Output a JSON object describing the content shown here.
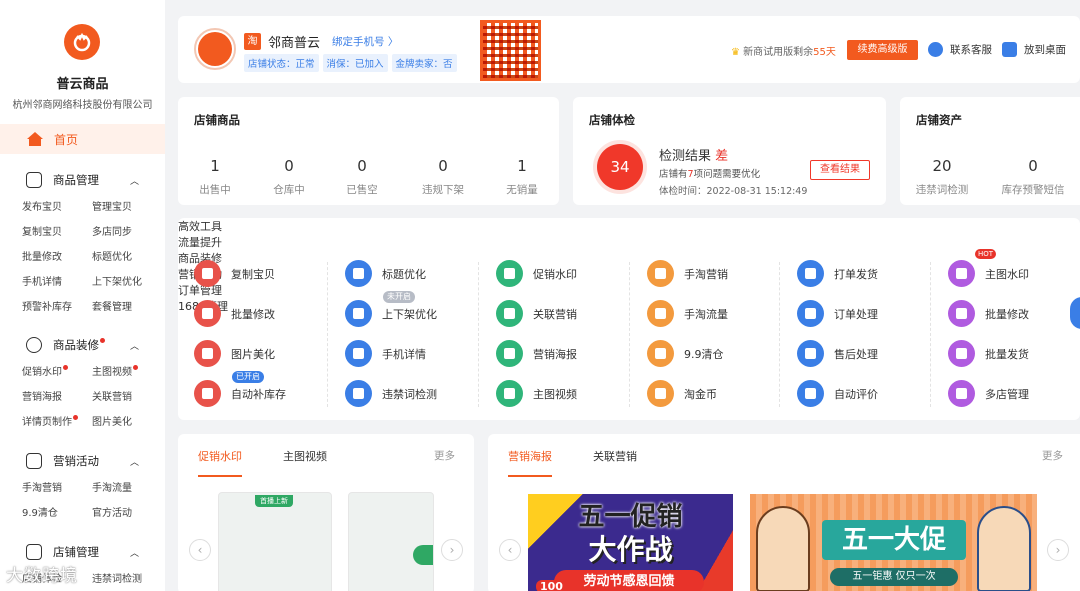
{
  "sidebar": {
    "app_name": "普云商品",
    "company": "杭州邻商网络科技股份有限公司",
    "home": "首页",
    "groups": [
      {
        "title": "商品管理",
        "items": [
          "发布宝贝",
          "管理宝贝",
          "复制宝贝",
          "多店同步",
          "批量修改",
          "标题优化",
          "手机详情",
          "上下架优化",
          "预警补库存",
          "套餐管理"
        ]
      },
      {
        "title": "商品装修",
        "items": [
          "促销水印",
          "主图视频",
          "营销海报",
          "关联营销",
          "详情页制作",
          "图片美化"
        ]
      },
      {
        "title": "营销活动",
        "items": [
          "手淘营销",
          "手淘流量",
          "9.9清仓",
          "官方活动"
        ]
      },
      {
        "title": "店铺管理",
        "items": [
          "店铺体检",
          "违禁词检测"
        ]
      }
    ]
  },
  "topbar": {
    "tao": "淘",
    "shop_name": "邻商普云",
    "bind_phone": "绑定手机号 〉",
    "tags": [
      "店铺状态：正常",
      "消保：已加入",
      "金牌卖家：否"
    ],
    "trial_prefix": "新商试用版剩余",
    "trial_days": "55天",
    "upgrade": "续费高级版",
    "contact": "联系客服",
    "desktop": "放到桌面"
  },
  "goods": {
    "title": "店铺商品",
    "stats": [
      {
        "num": "1",
        "label": "出售中"
      },
      {
        "num": "0",
        "label": "仓库中"
      },
      {
        "num": "0",
        "label": "已售空"
      },
      {
        "num": "0",
        "label": "违规下架"
      },
      {
        "num": "1",
        "label": "无销量"
      }
    ]
  },
  "check": {
    "title": "店铺体检",
    "score": "34",
    "result_label": "检测结果",
    "result": "差",
    "desc_pre": "店铺有",
    "desc_num": "7",
    "desc_post": "项问题需要优化",
    "time": "体检时间：2022-08-31 15:12:49",
    "button": "查看结果"
  },
  "assets": {
    "title": "店铺资产",
    "stats": [
      {
        "num": "20",
        "label": "违禁词检测"
      },
      {
        "num": "0",
        "label": "库存预警短信"
      }
    ]
  },
  "tools": [
    {
      "title": "高效工具",
      "items": [
        {
          "label": "复制宝贝",
          "color": "#e8524a"
        },
        {
          "label": "批量修改",
          "color": "#e8524a"
        },
        {
          "label": "图片美化",
          "color": "#e8524a"
        },
        {
          "label": "自动补库存",
          "color": "#e8524a",
          "badge": "已开启"
        }
      ]
    },
    {
      "title": "流量提升",
      "items": [
        {
          "label": "标题优化",
          "color": "#3a7ee6"
        },
        {
          "label": "上下架优化",
          "color": "#3a7ee6",
          "badge": "未开启"
        },
        {
          "label": "手机详情",
          "color": "#3a7ee6"
        },
        {
          "label": "违禁词检测",
          "color": "#3a7ee6"
        }
      ]
    },
    {
      "title": "商品装修",
      "items": [
        {
          "label": "促销水印",
          "color": "#2fb57a"
        },
        {
          "label": "关联营销",
          "color": "#2fb57a"
        },
        {
          "label": "营销海报",
          "color": "#2fb57a"
        },
        {
          "label": "主图视频",
          "color": "#2fb57a"
        }
      ]
    },
    {
      "title": "营销活动",
      "items": [
        {
          "label": "手淘营销",
          "color": "#f39a3e"
        },
        {
          "label": "手淘流量",
          "color": "#f39a3e"
        },
        {
          "label": "9.9清仓",
          "color": "#f39a3e"
        },
        {
          "label": "淘金币",
          "color": "#f39a3e"
        }
      ]
    },
    {
      "title": "订单管理",
      "items": [
        {
          "label": "打单发货",
          "color": "#3a7ee6"
        },
        {
          "label": "订单处理",
          "color": "#3a7ee6"
        },
        {
          "label": "售后处理",
          "color": "#3a7ee6"
        },
        {
          "label": "自动评价",
          "color": "#3a7ee6"
        }
      ]
    },
    {
      "title": "1688管理",
      "items": [
        {
          "label": "主图水印",
          "color": "#b05be0"
        },
        {
          "label": "批量修改",
          "color": "#b05be0"
        },
        {
          "label": "批量发货",
          "color": "#b05be0"
        },
        {
          "label": "多店管理",
          "color": "#b05be0"
        }
      ]
    }
  ],
  "hot": "HOT",
  "panel_left": {
    "tabs": [
      "促销水印",
      "主图视频"
    ],
    "more": "更多",
    "thumb_tag": "首播上新"
  },
  "panel_right": {
    "tabs": [
      "营销海报",
      "关联营销"
    ],
    "more": "更多",
    "poster1": {
      "line1": "五一促销",
      "line2": "大作战",
      "sub": "劳动节感恩回馈",
      "num": "100"
    },
    "poster2": {
      "title": "五一大促",
      "sub": "五一钜惠 仅只一次"
    }
  },
  "watermark": "大数跨境"
}
